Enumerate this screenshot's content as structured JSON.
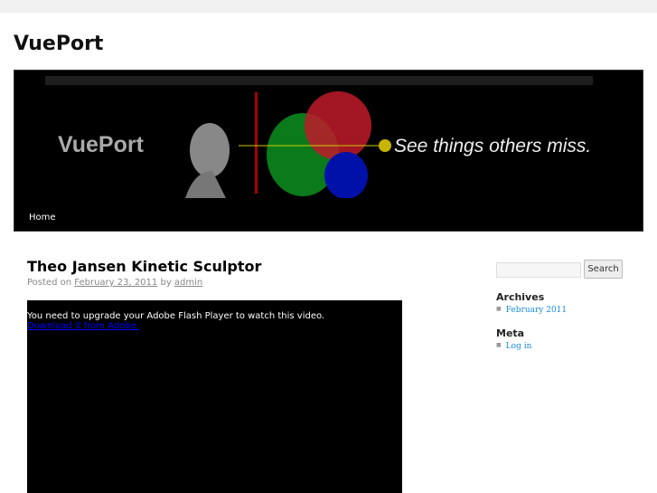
{
  "site": {
    "title": "VuePort"
  },
  "banner": {
    "logo": "VuePort",
    "tagline": "See things others miss."
  },
  "nav": {
    "items": [
      {
        "label": "Home"
      }
    ]
  },
  "post": {
    "title": "Theo Jansen Kinetic Sculptor",
    "posted_on": "Posted on",
    "date": "February 23, 2011",
    "by": "by",
    "author": "admin",
    "flash_message": "You need to upgrade your Adobe Flash Player to watch this video.",
    "flash_link": "Download it from Adobe."
  },
  "sidebar": {
    "search_button": "Search",
    "widgets": [
      {
        "title": "Archives",
        "items": [
          "February 2011"
        ]
      },
      {
        "title": "Meta",
        "items": [
          "Log in"
        ]
      }
    ]
  }
}
